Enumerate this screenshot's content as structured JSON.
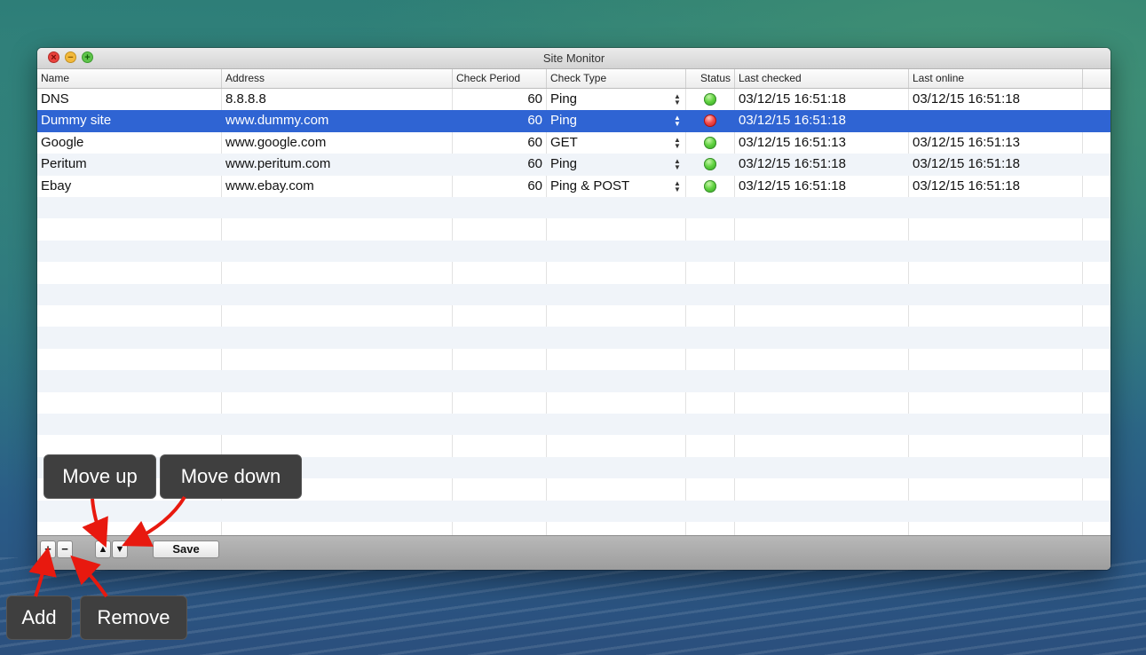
{
  "window": {
    "title": "Site Monitor"
  },
  "columns": [
    "Name",
    "Address",
    "Check Period",
    "Check Type",
    "Status",
    "Last checked",
    "Last online"
  ],
  "rows": [
    {
      "name": "DNS",
      "address": "8.8.8.8",
      "period": "60",
      "type": "Ping",
      "status": "green",
      "last_checked": "03/12/15 16:51:18",
      "last_online": "03/12/15 16:51:18"
    },
    {
      "name": "Dummy site",
      "address": "www.dummy.com",
      "period": "60",
      "type": "Ping",
      "status": "red",
      "last_checked": "03/12/15 16:51:18",
      "last_online": ""
    },
    {
      "name": "Google",
      "address": "www.google.com",
      "period": "60",
      "type": "GET",
      "status": "green",
      "last_checked": "03/12/15 16:51:13",
      "last_online": "03/12/15 16:51:13"
    },
    {
      "name": "Peritum",
      "address": "www.peritum.com",
      "period": "60",
      "type": "Ping",
      "status": "green",
      "last_checked": "03/12/15 16:51:18",
      "last_online": "03/12/15 16:51:18"
    },
    {
      "name": "Ebay",
      "address": "www.ebay.com",
      "period": "60",
      "type": "Ping & POST",
      "status": "green",
      "last_checked": "03/12/15 16:51:18",
      "last_online": "03/12/15 16:51:18"
    }
  ],
  "selected_row": "Dummy site",
  "toolbar": {
    "add": "+",
    "remove": "−",
    "move_up": "▲",
    "move_down": "▼",
    "save": "Save"
  },
  "callouts": {
    "move_up": "Move up",
    "move_down": "Move down",
    "add": "Add",
    "remove": "Remove"
  },
  "colors": {
    "selection": "#2f64d3",
    "status_ok": "#5fd23f",
    "status_down": "#f24848"
  }
}
